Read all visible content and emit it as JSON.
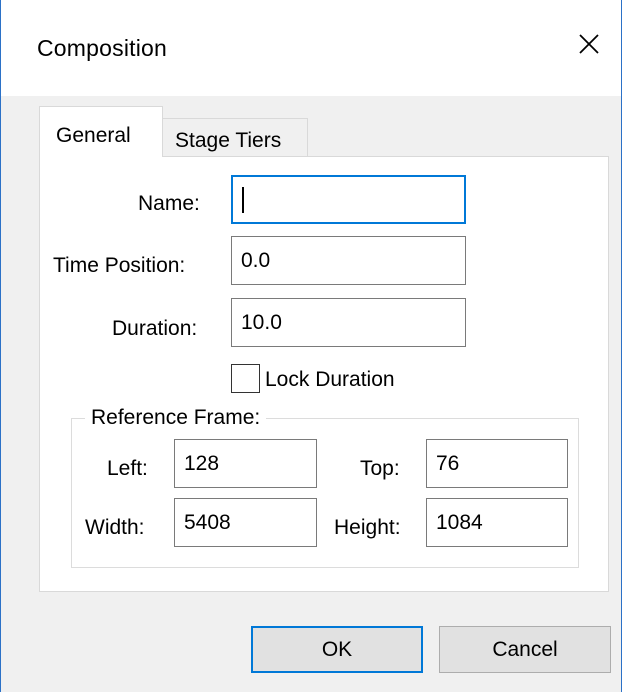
{
  "dialog": {
    "title": "Composition"
  },
  "tabs": [
    {
      "label": "General",
      "active": true
    },
    {
      "label": "Stage Tiers",
      "active": false
    }
  ],
  "general": {
    "name_label": "Name:",
    "name_value": "",
    "time_position_label": "Time Position:",
    "time_position_value": "0.0",
    "duration_label": "Duration:",
    "duration_value": "10.0",
    "lock_duration_label": "Lock Duration",
    "lock_duration_checked": false
  },
  "reference_frame": {
    "legend": "Reference Frame:",
    "left_label": "Left:",
    "left_value": "128",
    "top_label": "Top:",
    "top_value": "76",
    "width_label": "Width:",
    "width_value": "5408",
    "height_label": "Height:",
    "height_value": "1084"
  },
  "buttons": {
    "ok_label": "OK",
    "cancel_label": "Cancel"
  },
  "colors": {
    "focus_accent": "#0078d7",
    "dialog_background": "#f0f0f0",
    "window_border": "#2b71c7"
  },
  "icons": {
    "close": "close-icon"
  }
}
